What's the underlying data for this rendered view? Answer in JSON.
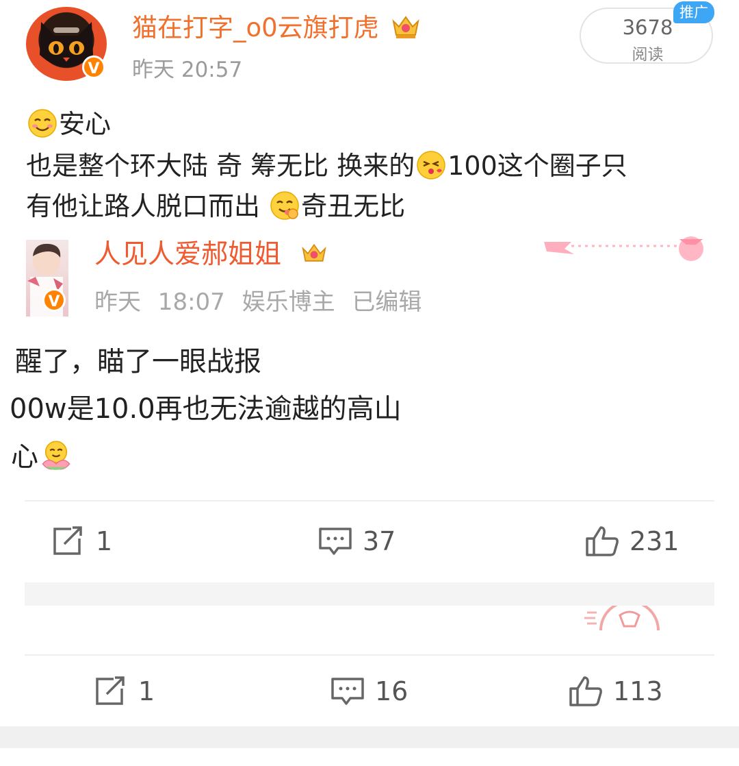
{
  "post": {
    "username": "猫在打字_o0云旗打虎",
    "time": "昨天 20:57",
    "read_count": "3678",
    "read_label": "阅读",
    "promo_tag": "推广",
    "avatar_badge": "V",
    "lines": [
      {
        "segments": [
          {
            "emoji": "smiling-blush-emoji"
          },
          {
            "text": "安心"
          }
        ]
      },
      {
        "segments": [
          {
            "text": "也是整个环大陆 奇 筹无比 换来的"
          },
          {
            "emoji": "kiss-emoji"
          },
          {
            "text": "100这个圈子只"
          }
        ]
      },
      {
        "segments": [
          {
            "text": "有他让路人脱口而出 "
          },
          {
            "emoji": "yummy-emoji"
          },
          {
            "text": "奇丑无比"
          }
        ]
      }
    ]
  },
  "quoted_post": {
    "username": "人见人爱郝姐姐",
    "time": "昨天 18:07",
    "role": "娱乐博主",
    "edited": "已编辑",
    "avatar_badge": "V",
    "lines": [
      "醒了，瞄了一眼战报",
      "00w是10.0再也无法逾越的高山",
      "心"
    ],
    "lotus_emoji": "lotus-emoji"
  },
  "action_bar_1": {
    "repost": "1",
    "comment": "37",
    "like": "231"
  },
  "action_bar_2": {
    "repost": "1",
    "comment": "16",
    "like": "113"
  },
  "icons": {
    "repost": "share-icon",
    "comment": "comment-icon",
    "like": "thumbs-up-icon",
    "crown": "crown-icon"
  },
  "colors": {
    "username": "#f0702e",
    "quote_username": "#f05a2e",
    "verified_badge": "#ff8200",
    "promo_tag": "#3da6f5",
    "meta_text": "#9b9b9b"
  }
}
